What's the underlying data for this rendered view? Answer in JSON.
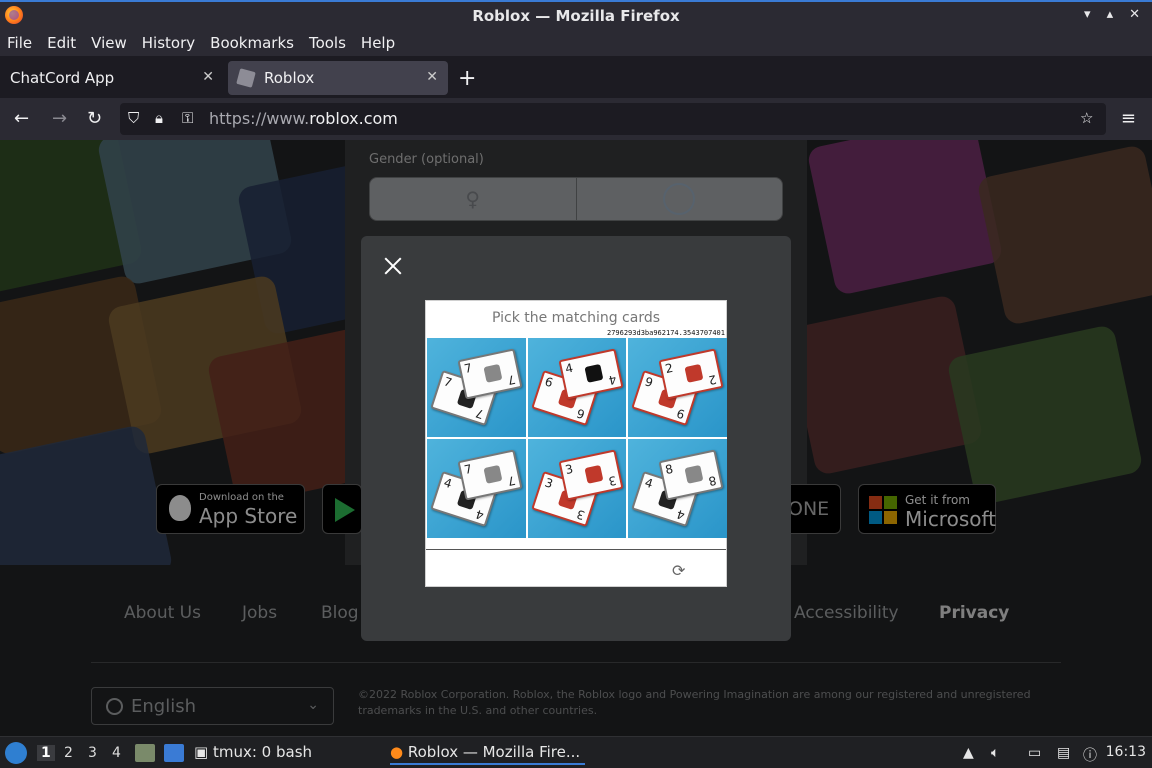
{
  "window": {
    "title": "Roblox — Mozilla Firefox"
  },
  "menubar": {
    "items": [
      "File",
      "Edit",
      "View",
      "History",
      "Bookmarks",
      "Tools",
      "Help"
    ]
  },
  "tabs": [
    {
      "label": "ChatCord App",
      "active": false
    },
    {
      "label": "Roblox",
      "active": true
    }
  ],
  "urlbar": {
    "scheme": "https://www.",
    "domain": "roblox.com"
  },
  "signup": {
    "gender_label": "Gender (optional)"
  },
  "stores": {
    "apple_small": "Download on the",
    "apple_big": "App Store",
    "xbox_text": "ONE",
    "ms_small": "Get it from",
    "ms_big": "Microsoft"
  },
  "footer": {
    "links": [
      "About Us",
      "Jobs",
      "Blog",
      "Accessibility",
      "Privacy"
    ],
    "language": "English",
    "copyright": "©2022 Roblox Corporation. Roblox, the Roblox logo and Powering Imagination are among our registered and unregistered trademarks in the U.S. and other countries."
  },
  "captcha": {
    "prompt": "Pick the matching cards",
    "token": "2796293d3ba962174.3543707401",
    "cells": [
      {
        "cards": [
          {
            "color": "gray",
            "n": "7",
            "sym": "#222"
          },
          {
            "color": "gray",
            "n": "7",
            "sym": "#888"
          }
        ]
      },
      {
        "cards": [
          {
            "color": "red",
            "n": "6",
            "sym": "#c0392b"
          },
          {
            "color": "red",
            "n": "4",
            "sym": "#111"
          }
        ]
      },
      {
        "cards": [
          {
            "color": "red",
            "n": "9",
            "sym": "#c0392b"
          },
          {
            "color": "red",
            "n": "2",
            "sym": "#c0392b"
          }
        ]
      },
      {
        "cards": [
          {
            "color": "gray",
            "n": "4",
            "sym": "#222"
          },
          {
            "color": "gray",
            "n": "7",
            "sym": "#888"
          }
        ]
      },
      {
        "cards": [
          {
            "color": "red",
            "n": "3",
            "sym": "#c0392b"
          },
          {
            "color": "red",
            "n": "3",
            "sym": "#c0392b"
          }
        ]
      },
      {
        "cards": [
          {
            "color": "gray",
            "n": "4",
            "sym": "#222"
          },
          {
            "color": "gray",
            "n": "8",
            "sym": "#888"
          }
        ]
      }
    ]
  },
  "taskbar": {
    "workspaces": [
      "1",
      "2",
      "3",
      "4"
    ],
    "terminal_label": "tmux: 0 bash",
    "firefox_label": "Roblox — Mozilla Fire...",
    "clock": "16:13"
  },
  "colors": {
    "accent": "#3a7bd5",
    "page_bg": "#232527",
    "modal_bg": "#393b3d"
  }
}
